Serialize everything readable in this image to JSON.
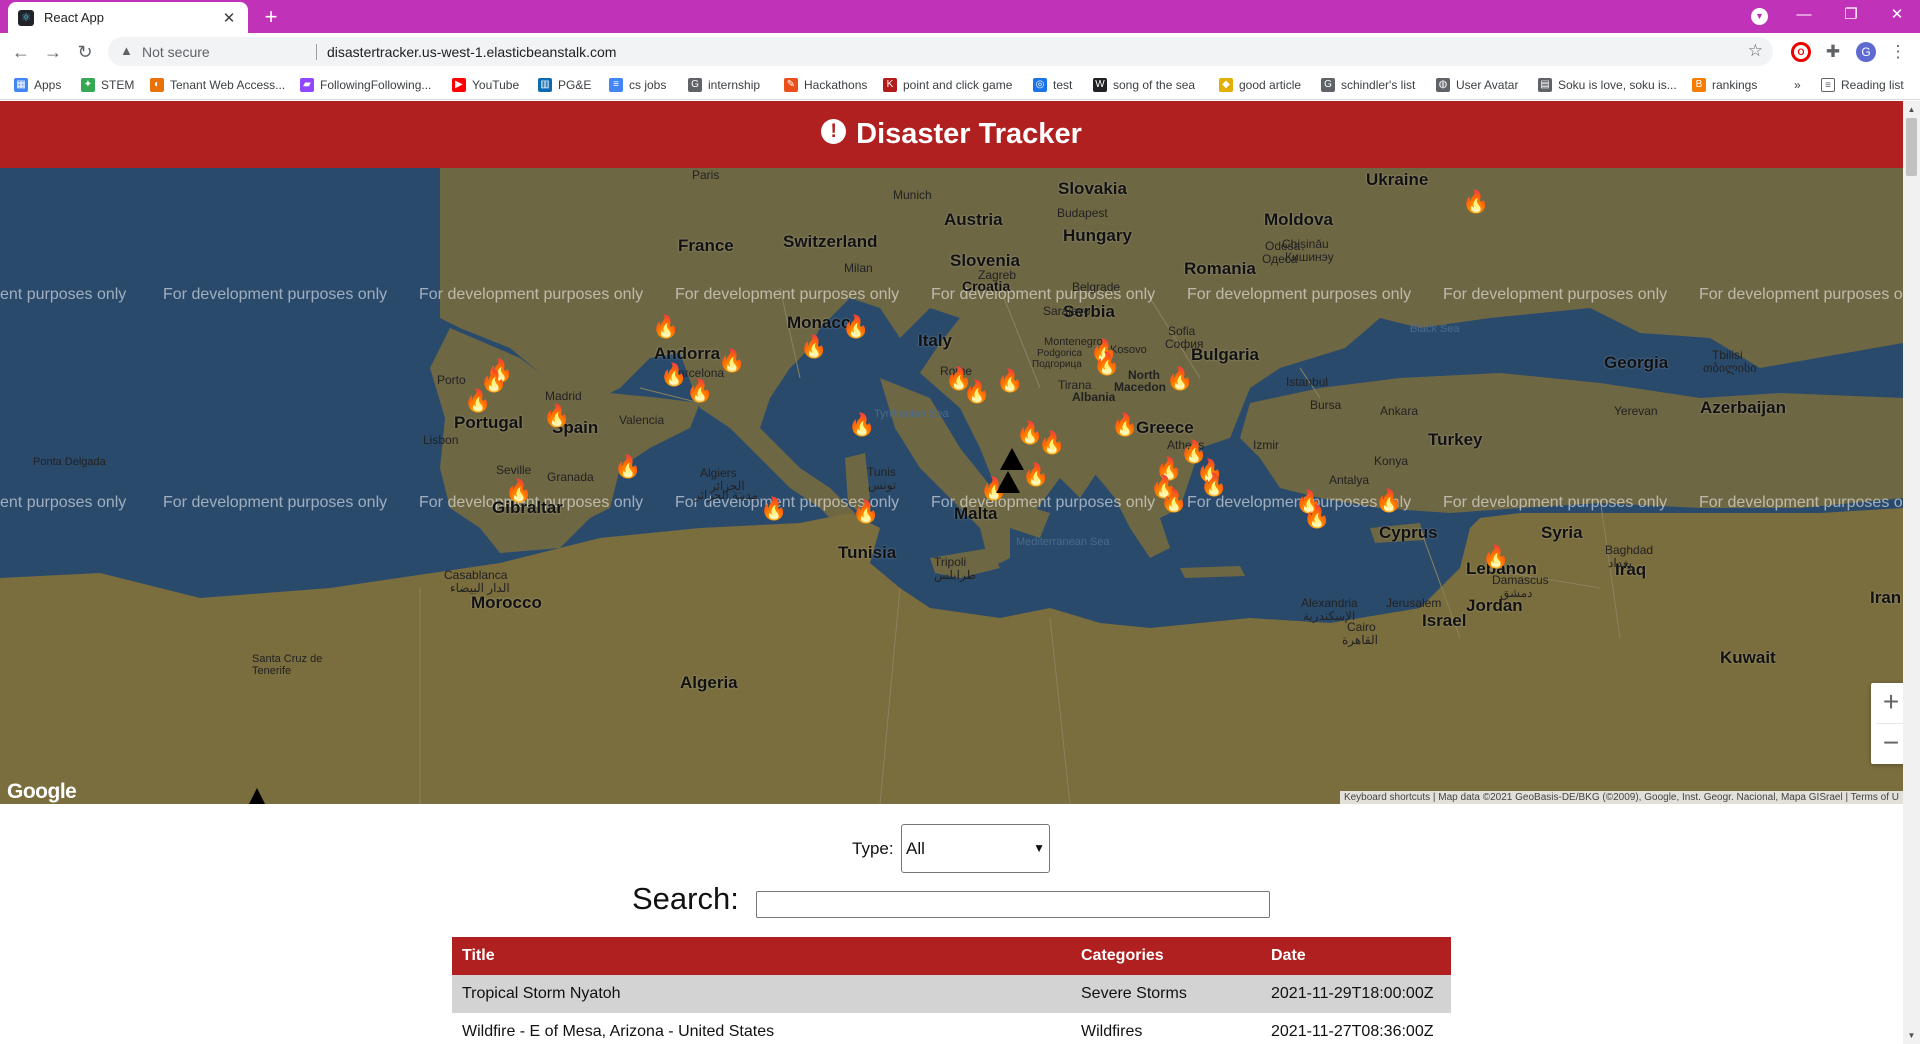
{
  "browser": {
    "tab_title": "React App",
    "new_tab_label": "+",
    "tab_close": "✕",
    "security_label": "Not secure",
    "url": "disastertracker.us-west-1.elasticbeanstalk.com",
    "profile_initial": "G",
    "bookmarks": [
      {
        "label": "Apps",
        "icon": "apps-grid-icon",
        "color": "#4285f4"
      },
      {
        "label": "STEM",
        "icon": "lightbulb-icon",
        "color": "#34a853"
      },
      {
        "label": "Tenant Web Access...",
        "icon": "tenant-icon",
        "color": "#e8710a"
      },
      {
        "label": "FollowingFollowing...",
        "icon": "twitch-icon",
        "color": "#9146ff"
      },
      {
        "label": "YouTube",
        "icon": "youtube-icon",
        "color": "#ff0000"
      },
      {
        "label": "PG&E",
        "icon": "pge-icon",
        "color": "#0b6ab2"
      },
      {
        "label": "cs jobs",
        "icon": "docs-icon",
        "color": "#4285f4"
      },
      {
        "label": "internship",
        "icon": "google-icon",
        "color": "#5f6368"
      },
      {
        "label": "Hackathons",
        "icon": "hackathon-icon",
        "color": "#e94e1b"
      },
      {
        "label": "point and click game",
        "icon": "game-icon",
        "color": "#b31b1b"
      },
      {
        "label": "test",
        "icon": "test-icon",
        "color": "#1a73e8"
      },
      {
        "label": "song of the sea",
        "icon": "wikipedia-icon",
        "color": "#202124"
      },
      {
        "label": "good article",
        "icon": "article-icon",
        "color": "#e2b007"
      },
      {
        "label": "schindler's list",
        "icon": "google-icon",
        "color": "#5f6368"
      },
      {
        "label": "User Avatar",
        "icon": "globe-icon",
        "color": "#5f6368"
      },
      {
        "label": "Soku is love, soku is...",
        "icon": "soku-icon",
        "color": "#5f6368"
      },
      {
        "label": "rankings",
        "icon": "blogger-icon",
        "color": "#f57d00"
      }
    ],
    "overflow_label": "»",
    "reading_list": "Reading list"
  },
  "app": {
    "title": "Disaster Tracker",
    "header_icon": "!",
    "map": {
      "watermark": "For development purposes only",
      "watermark_partial_left": "ent purposes only",
      "watermark_partial_right": "For development purposes onl",
      "countries": [
        "Ukraine",
        "Slovakia",
        "Moldova",
        "Austria",
        "Hungary",
        "France",
        "Switzerland",
        "Slovenia",
        "Romania",
        "Serbia",
        "Monaco",
        "Andorra",
        "Italy",
        "Bulgaria",
        "Georgia",
        "Portugal",
        "Spain",
        "Azerbaijan",
        "Greece",
        "Turkey",
        "Gibraltar",
        "Malta",
        "Cyprus",
        "Syria",
        "Tunisia",
        "Lebanon",
        "Iraq",
        "Morocco",
        "Jordan",
        "Israel",
        "Kuwait",
        "Algeria",
        "Iran",
        "Croatia"
      ],
      "cities": [
        "Paris",
        "Munich",
        "Budapest",
        "Chișinău",
        "Кишинэу",
        "Milan",
        "Zagreb",
        "Belgrade",
        "Sarajevo",
        "Sofia",
        "София",
        "Porto",
        "Madrid",
        "Barcelona",
        "Rome",
        "Montenegro",
        "Podgorica",
        "Подгорица",
        "Kosovo",
        "North",
        "Macedon",
        "Tirana",
        "Albania",
        "Istanbul",
        "Tbilisi",
        "თბილისი",
        "Yerevan",
        "Bursa",
        "Ankara",
        "Lisbon",
        "Valencia",
        "Izmir",
        "Konya",
        "Ponta Delgada",
        "Seville",
        "Granada",
        "Algiers",
        "الجزائر",
        "Tunis",
        "تونس",
        "Athens",
        "Antalya",
        "Casablanca",
        "الدار البيضاء",
        "Tripoli",
        "طرابلس",
        "Damascus",
        "دمشق",
        "Baghdad",
        "بغداد",
        "Alexandria",
        "الإسكندرية",
        "Jerusalem",
        "Cairo",
        "القاهرة",
        "Santa Cruz de Tenerife",
        "Одеса",
        "Odesa",
        "مدينة الجزائر"
      ],
      "seas": [
        "Black Sea",
        "Tyrrhenian Sea",
        "Mediterranean Sea"
      ],
      "google_label": "Google",
      "attribution": [
        "Keyboard shortcuts",
        "Map data ©2021 GeoBasis-DE/BKG (©2009), Google, Inst. Geogr. Nacional, Mapa GISrael",
        "Terms of U"
      ],
      "zoom_in": "+",
      "zoom_out": "−"
    },
    "filter": {
      "type_label": "Type:",
      "type_value": "All",
      "search_label": "Search:",
      "search_value": ""
    },
    "table": {
      "headers": [
        "Title",
        "Categories",
        "Date"
      ],
      "rows": [
        {
          "title": "Tropical Storm Nyatoh",
          "category": "Severe Storms",
          "date": "2021-11-29T18:00:00Z"
        },
        {
          "title": "Wildfire - E of Mesa, Arizona - United States",
          "category": "Wildfires",
          "date": "2021-11-27T08:36:00Z"
        }
      ]
    },
    "colors": {
      "brand_red": "#b02020",
      "chrome_purple": "#c033b8",
      "marker_red": "#ff1010",
      "water": "#2a4a6c",
      "land": "#6b6240",
      "row_alt": "#d3d3d3"
    }
  }
}
